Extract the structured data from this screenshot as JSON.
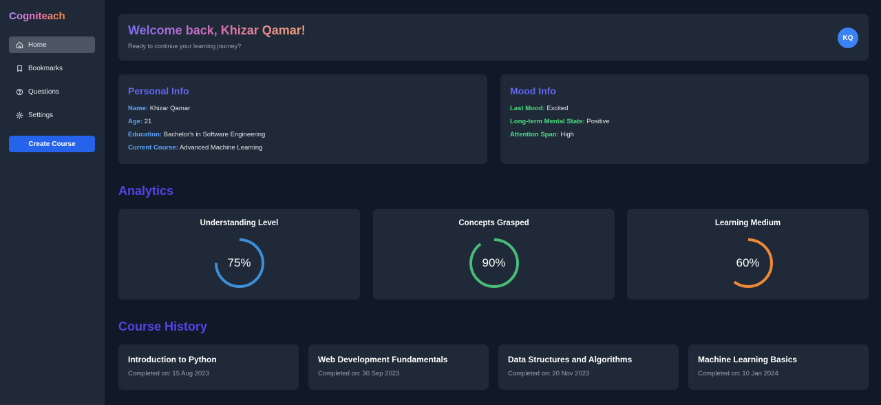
{
  "app": {
    "logo": "Cogniteach"
  },
  "sidebar": {
    "items": [
      {
        "label": "Home",
        "icon": "home-icon",
        "active": true
      },
      {
        "label": "Bookmarks",
        "icon": "bookmark-icon",
        "active": false
      },
      {
        "label": "Questions",
        "icon": "question-icon",
        "active": false
      },
      {
        "label": "Settings",
        "icon": "gear-icon",
        "active": false
      }
    ],
    "create_button": "Create Course"
  },
  "header": {
    "welcome": "Welcome back, Khizar Qamar!",
    "subtitle": "Ready to continue your learning journey?",
    "avatar_initials": "KQ"
  },
  "personal_info": {
    "title": "Personal Info",
    "rows": [
      {
        "label": "Name:",
        "value": "Khizar Qamar"
      },
      {
        "label": "Age:",
        "value": "21"
      },
      {
        "label": "Education:",
        "value": "Bachelor's in Software Engineering"
      },
      {
        "label": "Current Course:",
        "value": "Advanced Machine Learning"
      }
    ]
  },
  "mood_info": {
    "title": "Mood Info",
    "rows": [
      {
        "label": "Last Mood:",
        "value": "Excited"
      },
      {
        "label": "Long-term Mental State:",
        "value": "Positive"
      },
      {
        "label": "Attention Span:",
        "value": "High"
      }
    ]
  },
  "analytics": {
    "title": "Analytics",
    "cards": [
      {
        "title": "Understanding Level",
        "value": "75%",
        "percent": 75,
        "color": "#3b8fd9"
      },
      {
        "title": "Concepts Grasped",
        "value": "90%",
        "percent": 90,
        "color": "#48bb78"
      },
      {
        "title": "Learning Medium",
        "value": "60%",
        "percent": 60,
        "color": "#ed8936"
      }
    ]
  },
  "course_history": {
    "title": "Course History",
    "courses": [
      {
        "name": "Introduction to Python",
        "completed": "Completed on: 15 Aug 2023"
      },
      {
        "name": "Web Development Fundamentals",
        "completed": "Completed on: 30 Sep 2023"
      },
      {
        "name": "Data Structures and Algorithms",
        "completed": "Completed on: 20 Nov 2023"
      },
      {
        "name": "Machine Learning Basics",
        "completed": "Completed on: 10 Jan 2024"
      }
    ]
  },
  "colors": {
    "accent": "#2563eb",
    "heading": "#4f46e5",
    "card_bg": "#1f2937",
    "page_bg": "#111827"
  }
}
